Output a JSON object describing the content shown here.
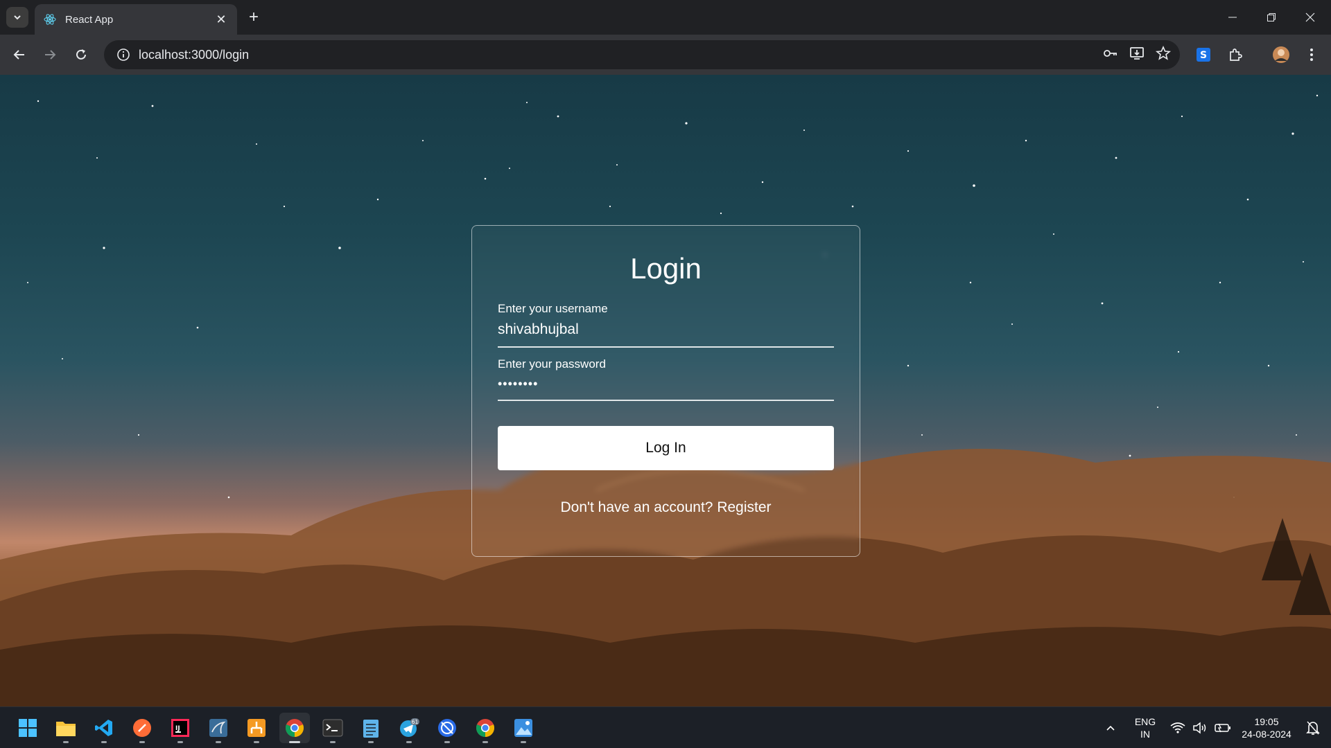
{
  "browser": {
    "tab_title": "React App",
    "url": "localhost:3000/login"
  },
  "login": {
    "title": "Login",
    "username_label": "Enter your username",
    "username_value": "shivabhujbal",
    "password_label": "Enter your password",
    "password_value": "••••••••",
    "login_button": "Log In",
    "register_prompt": "Don't have an account?",
    "register_link": "Register"
  },
  "taskbar": {
    "apps": [
      "start",
      "file-explorer",
      "vscode",
      "postman",
      "intellij",
      "mysql-workbench",
      "git-tool",
      "chrome",
      "terminal",
      "notepad",
      "telegram",
      "vpn-client",
      "chrome-profile",
      "photos"
    ],
    "telegram_badge": "61",
    "language": "ENG",
    "region": "IN",
    "time": "19:05",
    "date": "24-08-2024"
  },
  "colors": {
    "chrome_dark": "#202124",
    "toolbar": "#35363a",
    "taskbar": "#1c2027",
    "card_border": "#ffffff"
  }
}
